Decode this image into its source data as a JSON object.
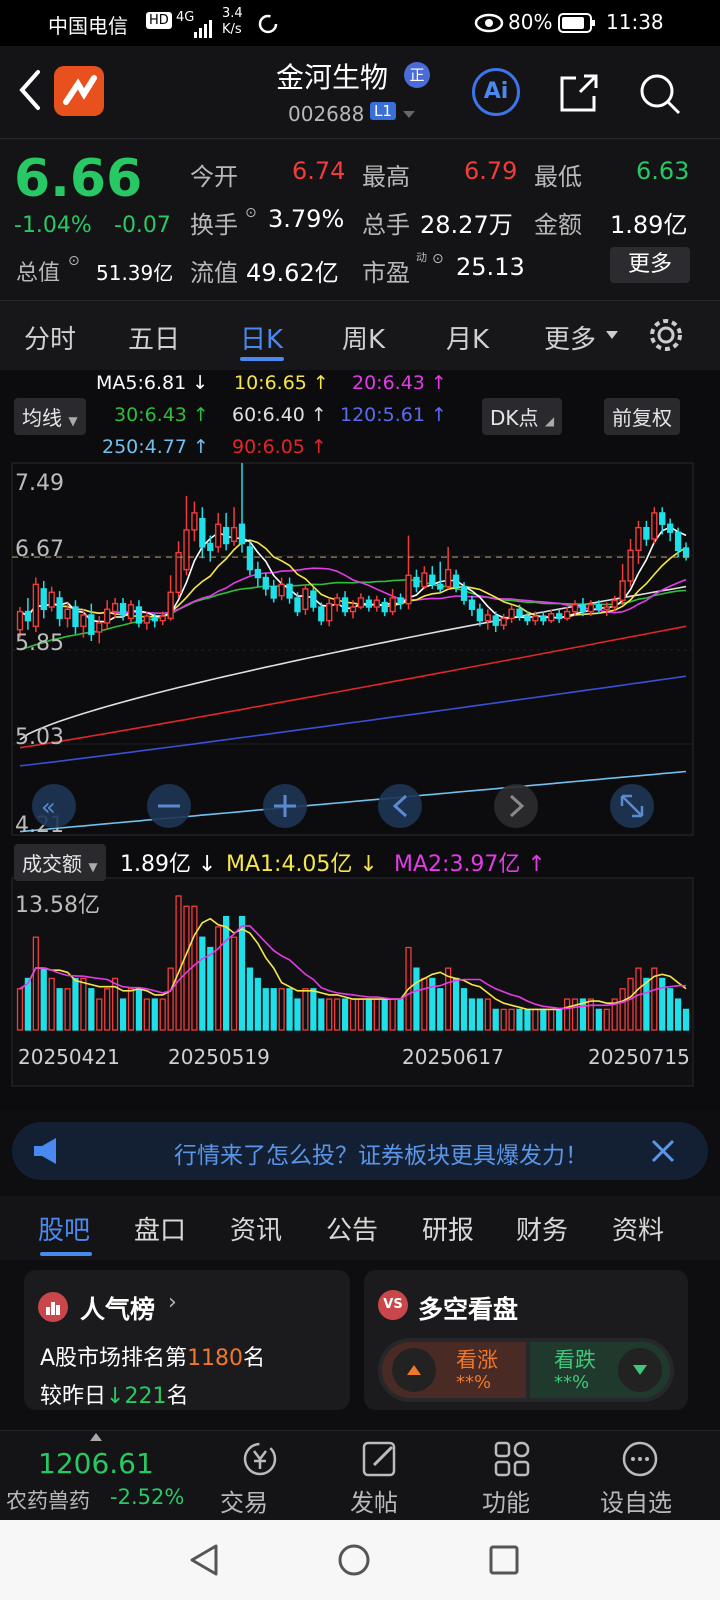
{
  "status_bar": {
    "carrier": "中国电信",
    "hd": "HD",
    "net": "4G",
    "speed_top": "3.4",
    "speed_bottom": "K/s",
    "battery": "80%",
    "time": "11:38"
  },
  "header": {
    "stock_name": "金河生物",
    "badge": "正",
    "code": "002688",
    "level": "L1",
    "ai": "Ai"
  },
  "quote": {
    "price": "6.66",
    "change_pct": "-1.04%",
    "change": "-0.07",
    "open_label": "今开",
    "open": "6.74",
    "high_label": "最高",
    "high": "6.79",
    "low_label": "最低",
    "low": "6.63",
    "turnover_label": "换手",
    "turnover": "3.79%",
    "volume_label": "总手",
    "volume": "28.27万",
    "amount_label": "金额",
    "amount": "1.89亿",
    "mktcap_label": "总值",
    "mktcap": "51.39亿",
    "float_label": "流值",
    "float": "49.62亿",
    "pe_label": "市盈",
    "pe_sup": "动",
    "pe": "25.13",
    "more_btn": "更多"
  },
  "tabs": [
    "分时",
    "五日",
    "日K",
    "周K",
    "月K",
    "更多"
  ],
  "active_tab": "日K",
  "ma_legend": {
    "ma5": "MA5:6.81 ↓",
    "ma10": "10:6.65 ↑",
    "ma20": "20:6.43 ↑",
    "ma30": "30:6.43 ↑",
    "ma60": "60:6.40 ↑",
    "ma120": "120:5.61 ↑",
    "ma250": "250:4.77 ↑",
    "ma90": "90:6.05 ↑",
    "junxian_btn": "均线",
    "dk_btn": "DK点",
    "fq_btn": "前复权"
  },
  "colors": {
    "up": "#f23c3c",
    "down": "#1fe0e8",
    "ma5": "#ffffff",
    "ma10": "#f5e64b",
    "ma20": "#e23ce6",
    "ma30": "#2fbd3c",
    "ma60": "#e0e0e0",
    "ma90": "#e0262a",
    "ma120": "#3a4fd8",
    "ma250": "#70c0f0"
  },
  "price_axis": [
    "7.49",
    "6.67",
    "5.85",
    "5.03",
    "4.21"
  ],
  "volume_legend": {
    "label": "成交额",
    "value": "1.89亿 ↓",
    "ma1": "MA1:4.05亿 ↓",
    "ma2": "MA2:3.97亿 ↑",
    "axis_max": "13.58亿"
  },
  "date_axis": [
    "20250421",
    "20250519",
    "20250617",
    "20250715"
  ],
  "chart_data": {
    "type": "candlestick",
    "price_range": [
      4.21,
      7.49
    ],
    "volume_max_yi": 13.58,
    "candles": [
      [
        6.02,
        6.18,
        5.95,
        6.22
      ],
      [
        6.18,
        6.1,
        6.02,
        6.3
      ],
      [
        6.05,
        6.42,
        6.0,
        6.48
      ],
      [
        6.38,
        6.2,
        6.12,
        6.45
      ],
      [
        6.22,
        6.35,
        6.18,
        6.4
      ],
      [
        6.3,
        6.12,
        6.05,
        6.36
      ],
      [
        6.12,
        6.2,
        6.04,
        6.26
      ],
      [
        6.22,
        6.05,
        5.98,
        6.28
      ],
      [
        6.05,
        6.15,
        5.95,
        6.2
      ],
      [
        6.15,
        5.98,
        5.92,
        6.25
      ],
      [
        6.0,
        6.08,
        5.9,
        6.14
      ],
      [
        6.08,
        6.2,
        6.02,
        6.28
      ],
      [
        6.18,
        6.25,
        6.12,
        6.3
      ],
      [
        6.25,
        6.15,
        6.1,
        6.3
      ],
      [
        6.12,
        6.24,
        6.08,
        6.28
      ],
      [
        6.22,
        6.08,
        6.04,
        6.28
      ],
      [
        6.08,
        6.14,
        6.02,
        6.18
      ],
      [
        6.12,
        6.1,
        6.04,
        6.16
      ],
      [
        6.1,
        6.14,
        6.06,
        6.18
      ],
      [
        6.12,
        6.35,
        6.1,
        6.5
      ],
      [
        6.35,
        6.7,
        6.3,
        6.8
      ],
      [
        6.55,
        6.9,
        6.5,
        7.2
      ],
      [
        6.9,
        7.05,
        6.8,
        7.15
      ],
      [
        7.0,
        6.75,
        6.65,
        7.1
      ],
      [
        6.78,
        6.72,
        6.62,
        6.85
      ],
      [
        6.75,
        6.95,
        6.7,
        7.05
      ],
      [
        6.92,
        6.78,
        6.72,
        7.05
      ],
      [
        6.8,
        6.92,
        6.76,
        7.1
      ],
      [
        6.95,
        6.78,
        6.7,
        7.49
      ],
      [
        6.75,
        6.55,
        6.5,
        6.8
      ],
      [
        6.55,
        6.48,
        6.4,
        6.62
      ],
      [
        6.48,
        6.38,
        6.32,
        6.52
      ],
      [
        6.4,
        6.3,
        6.26,
        6.46
      ],
      [
        6.32,
        6.42,
        6.28,
        6.48
      ],
      [
        6.42,
        6.3,
        6.25,
        6.48
      ],
      [
        6.3,
        6.18,
        6.14,
        6.35
      ],
      [
        6.2,
        6.38,
        6.15,
        6.42
      ],
      [
        6.36,
        6.22,
        6.18,
        6.4
      ],
      [
        6.22,
        6.1,
        6.06,
        6.26
      ],
      [
        6.1,
        6.25,
        6.05,
        6.3
      ],
      [
        6.24,
        6.3,
        6.18,
        6.34
      ],
      [
        6.3,
        6.18,
        6.14,
        6.36
      ],
      [
        6.18,
        6.22,
        6.12,
        6.28
      ],
      [
        6.22,
        6.3,
        6.2,
        6.34
      ],
      [
        6.28,
        6.22,
        6.18,
        6.32
      ],
      [
        6.22,
        6.28,
        6.18,
        6.32
      ],
      [
        6.26,
        6.18,
        6.14,
        6.3
      ],
      [
        6.18,
        6.3,
        6.15,
        6.38
      ],
      [
        6.3,
        6.25,
        6.2,
        6.34
      ],
      [
        6.25,
        6.5,
        6.2,
        6.85
      ],
      [
        6.48,
        6.4,
        6.35,
        6.55
      ],
      [
        6.4,
        6.52,
        6.38,
        6.58
      ],
      [
        6.5,
        6.42,
        6.38,
        6.58
      ],
      [
        6.42,
        6.38,
        6.35,
        6.62
      ],
      [
        6.4,
        6.55,
        6.38,
        6.75
      ],
      [
        6.5,
        6.4,
        6.35,
        6.55
      ],
      [
        6.4,
        6.28,
        6.24,
        6.44
      ],
      [
        6.28,
        6.2,
        6.14,
        6.32
      ],
      [
        6.2,
        6.1,
        6.05,
        6.25
      ],
      [
        6.1,
        6.15,
        6.02,
        6.2
      ],
      [
        6.14,
        6.06,
        6.0,
        6.18
      ],
      [
        6.06,
        6.12,
        6.02,
        6.16
      ],
      [
        6.12,
        6.2,
        6.08,
        6.24
      ],
      [
        6.2,
        6.14,
        6.1,
        6.24
      ],
      [
        6.14,
        6.1,
        6.06,
        6.18
      ],
      [
        6.1,
        6.14,
        6.06,
        6.18
      ],
      [
        6.14,
        6.1,
        6.06,
        6.18
      ],
      [
        6.1,
        6.16,
        6.08,
        6.2
      ],
      [
        6.16,
        6.12,
        6.08,
        6.2
      ],
      [
        6.12,
        6.18,
        6.1,
        6.22
      ],
      [
        6.18,
        6.24,
        6.14,
        6.28
      ],
      [
        6.24,
        6.18,
        6.14,
        6.3
      ],
      [
        6.18,
        6.24,
        6.14,
        6.28
      ],
      [
        6.24,
        6.2,
        6.16,
        6.28
      ],
      [
        6.2,
        6.22,
        6.14,
        6.26
      ],
      [
        6.22,
        6.28,
        6.18,
        6.32
      ],
      [
        6.28,
        6.45,
        6.24,
        6.6
      ],
      [
        6.45,
        6.72,
        6.4,
        6.82
      ],
      [
        6.72,
        6.92,
        6.6,
        6.98
      ],
      [
        6.92,
        6.82,
        6.76,
        6.98
      ],
      [
        6.82,
        7.05,
        6.78,
        7.1
      ],
      [
        7.05,
        6.95,
        6.86,
        7.1
      ],
      [
        6.95,
        6.88,
        6.8,
        7.0
      ],
      [
        6.88,
        6.72,
        6.66,
        6.92
      ],
      [
        6.74,
        6.66,
        6.63,
        6.79
      ]
    ],
    "volumes_yi": [
      4,
      5,
      9,
      6,
      5,
      4,
      4,
      5,
      5,
      4,
      3,
      4,
      5,
      3,
      4,
      4,
      3,
      3,
      3,
      6,
      13,
      12,
      12,
      9,
      8,
      10,
      11,
      9,
      11,
      6,
      5,
      4,
      4,
      4,
      4,
      3,
      4,
      4,
      3,
      3,
      3,
      3,
      3,
      3,
      3,
      3,
      3,
      3,
      3,
      8,
      6,
      5,
      5,
      4,
      6,
      5,
      4,
      3,
      3,
      3,
      2,
      2,
      2,
      2,
      2,
      2,
      2,
      2,
      2,
      3,
      3,
      3,
      3,
      2,
      2,
      3,
      4,
      5,
      6,
      5,
      6,
      5,
      4,
      3,
      2
    ]
  },
  "banner": {
    "text": "行情来了怎么投？证券板块更具爆发力！"
  },
  "sub_tabs": [
    "股吧",
    "盘口",
    "资讯",
    "公告",
    "研报",
    "财务",
    "资料"
  ],
  "active_sub_tab": "股吧",
  "popularity": {
    "title": "人气榜",
    "rank_prefix": "A股市场排名第",
    "rank": "1180",
    "rank_suffix": "名",
    "change_prefix": "较昨日",
    "change": "221",
    "change_suffix": "名"
  },
  "bull_bear": {
    "title": "多空看盘",
    "vs": "VS",
    "up_label": "看涨",
    "up_value": "**%",
    "down_label": "看跌",
    "down_value": "**%"
  },
  "bottom_bar": {
    "index_value": "1206.61",
    "index_name": "农药兽药",
    "index_change": "-2.52%",
    "trade": "交易",
    "post": "发帖",
    "func": "功能",
    "watch": "设自选"
  }
}
